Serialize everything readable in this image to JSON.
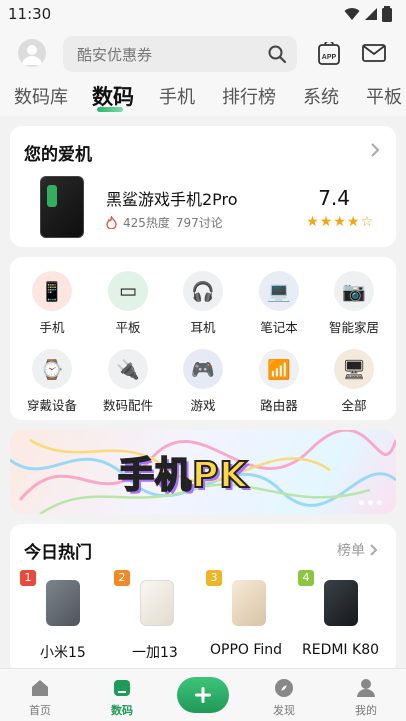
{
  "status_bar": {
    "time": "11:30"
  },
  "header": {
    "search_placeholder": "酷安优惠券",
    "app_icon_text": "APP"
  },
  "tabs": [
    {
      "label": "数码库",
      "active": false
    },
    {
      "label": "数码",
      "active": true
    },
    {
      "label": "手机",
      "active": false
    },
    {
      "label": "排行榜",
      "active": false
    },
    {
      "label": "系统",
      "active": false
    },
    {
      "label": "平板",
      "active": false
    }
  ],
  "my_phone": {
    "title": "您的爱机",
    "name": "黑鲨游戏手机2Pro",
    "heat": "425热度",
    "discussions": "797讨论",
    "score": "7.4",
    "stars": "★★★★☆"
  },
  "categories": [
    {
      "label": "手机",
      "icon": "phone"
    },
    {
      "label": "平板",
      "icon": "tablet"
    },
    {
      "label": "耳机",
      "icon": "headphones"
    },
    {
      "label": "笔记本",
      "icon": "laptop"
    },
    {
      "label": "智能家居",
      "icon": "smart-home"
    },
    {
      "label": "穿戴设备",
      "icon": "wearable"
    },
    {
      "label": "数码配件",
      "icon": "accessories"
    },
    {
      "label": "游戏",
      "icon": "game"
    },
    {
      "label": "路由器",
      "icon": "router"
    },
    {
      "label": "全部",
      "icon": "all"
    }
  ],
  "banner": {
    "text": "手机PK"
  },
  "hot_today": {
    "title": "今日热门",
    "more_label": "榜单",
    "items": [
      {
        "rank": "1",
        "name": "小米15",
        "badge_color": "#e84b3c",
        "img_color": "#6c737c"
      },
      {
        "rank": "2",
        "name": "一加13",
        "badge_color": "#f08a24",
        "img_color": "#f2ede6"
      },
      {
        "rank": "3",
        "name": "OPPO Find",
        "badge_color": "#f0b429",
        "img_color": "#f1e3cf"
      },
      {
        "rank": "4",
        "name": "REDMI K80",
        "badge_color": "#8cc63f",
        "img_color": "#2b2f33"
      }
    ]
  },
  "bottom_nav": [
    {
      "label": "首页",
      "active": false
    },
    {
      "label": "数码",
      "active": true
    },
    {
      "label": "发现",
      "active": false
    },
    {
      "label": "我的",
      "active": false
    }
  ]
}
